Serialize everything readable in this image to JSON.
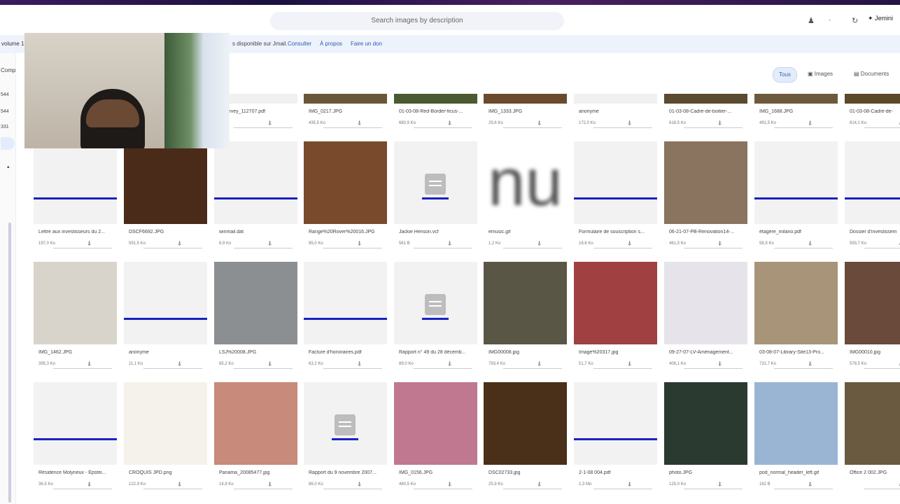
{
  "search": {
    "placeholder": "Search images by description"
  },
  "header": {
    "jemini": "✦ Jemini"
  },
  "infobar": {
    "left": "volume 1",
    "notice": "s disponible sur Jmail.",
    "consult": "Consulter",
    "about": "À propos",
    "donate": "Faire un don"
  },
  "sidebar": {
    "comp": "Comp",
    "n1": "544",
    "n2": "544",
    "n3": "331"
  },
  "filters": {
    "all": "Tous",
    "images": "Images",
    "documents": "Documents"
  },
  "row0": [
    {
      "name": "t_Survey_112707.pdf",
      "size": "",
      "color": "#f0f0f0"
    },
    {
      "name": "IMG_0217.JPG",
      "size": "435,5 Ko",
      "color": "#6a5638"
    },
    {
      "name": "01-03-08-Red-Border-ficus-...",
      "size": "680,9 Ko",
      "color": "#4b5a30"
    },
    {
      "name": "IMG_1333.JPG",
      "size": "29,6 Ko",
      "color": "#6b4a2c"
    },
    {
      "name": "anonyme",
      "size": "172,0 Ko",
      "color": "#f0f0f0"
    },
    {
      "name": "01-03-08-Cadre-de-boitier-...",
      "size": "618,5 Ko",
      "color": "#5a4a30"
    },
    {
      "name": "IMG_1688.JPG",
      "size": "491,5 Ko",
      "color": "#6d5a3c"
    },
    {
      "name": "01-03-08-Cadre-de-",
      "size": "614,1 Ko",
      "color": "#5d4828"
    }
  ],
  "row1": [
    {
      "name": "Lettre aux investisseurs du 2...",
      "size": "197,0 Ko",
      "kind": "blank"
    },
    {
      "name": "DSCF6692.JPG",
      "size": "591,5 Ko",
      "kind": "photo",
      "color": "#4a2a18"
    },
    {
      "name": "winmail.dat",
      "size": "6,9 Ko",
      "kind": "blank"
    },
    {
      "name": "Range%20Rover%20016.JPG",
      "size": "95,0 Ko",
      "kind": "photo",
      "color": "#7a4a2c"
    },
    {
      "name": "Jackie Henson.vcf",
      "size": "561 B",
      "kind": "doc"
    },
    {
      "name": "emusic.gif",
      "size": "1,2 Ko",
      "kind": "text",
      "text": "nu"
    },
    {
      "name": "Formulaire de souscription s...",
      "size": "16,6 Ko",
      "kind": "blank"
    },
    {
      "name": "06-21-07-PB-Renovation14-...",
      "size": "461,5 Ko",
      "kind": "photo",
      "color": "#8a7460"
    },
    {
      "name": "étagère_milano.pdf",
      "size": "58,9 Ko",
      "kind": "blank"
    },
    {
      "name": "Dossier d'investissem",
      "size": "593,7 Ko",
      "kind": "blank"
    }
  ],
  "row2": [
    {
      "name": "IMG_1462.JPG",
      "size": "395,3 Ko",
      "kind": "photo",
      "color": "#d8d4cc"
    },
    {
      "name": "anonyme",
      "size": "11,1 Ko",
      "kind": "blank"
    },
    {
      "name": "LSJ%20008.JPG",
      "size": "65,2 Ko",
      "kind": "photo",
      "color": "#8c8f92"
    },
    {
      "name": "Facture d'honoraires.pdf",
      "size": "63,2 Ko",
      "kind": "blank"
    },
    {
      "name": "Rapport n° 49 du 28 décemb...",
      "size": "89,0 Ko",
      "kind": "doc"
    },
    {
      "name": "IMG00008.jpg",
      "size": "793,4 Ko",
      "kind": "photo",
      "color": "#5a5646"
    },
    {
      "name": "Image%20317.jpg",
      "size": "51,7 Ko",
      "kind": "photo",
      "color": "#a04040"
    },
    {
      "name": "09-27-07-LV-Aménagement...",
      "size": "408,1 Ko",
      "kind": "photo",
      "color": "#e6e4ea"
    },
    {
      "name": "03-08-07-Library-Site13-Pro...",
      "size": "731,7 Ko",
      "kind": "photo",
      "color": "#a89478"
    },
    {
      "name": "IMG00010.jpg",
      "size": "578,5 Ko",
      "kind": "photo",
      "color": "#6a4a3a"
    }
  ],
  "row3": [
    {
      "name": "Résidence Molyneux - Epstei...",
      "size": "36,5 Ko",
      "kind": "blank"
    },
    {
      "name": "CROQUIS JPD.png",
      "size": "122,9 Ko",
      "kind": "photo",
      "color": "#f4f2ea"
    },
    {
      "name": "Panama_20085477.jpg",
      "size": "14,8 Ko",
      "kind": "photo",
      "color": "#c88a7a"
    },
    {
      "name": "Rapport du 9 novembre 2007...",
      "size": "86,0 Ko",
      "kind": "doc"
    },
    {
      "name": "IMG_0156.JPG",
      "size": "460,5 Ko",
      "kind": "photo",
      "color": "#c07890"
    },
    {
      "name": "DSC02733.jpg",
      "size": "25,9 Ko",
      "kind": "photo",
      "color": "#4a3018"
    },
    {
      "name": "2-1-08 004.pdf",
      "size": "2,3 Mo",
      "kind": "blank"
    },
    {
      "name": "photo.JPG",
      "size": "125,0 Ko",
      "kind": "photo",
      "color": "#2a3a30"
    },
    {
      "name": "pod_normal_header_left.gif",
      "size": "162 B",
      "kind": "photo",
      "color": "#9ab4d4"
    },
    {
      "name": "Office 2 002.JPG",
      "size": "",
      "kind": "photo",
      "color": "#6a5a40"
    }
  ]
}
